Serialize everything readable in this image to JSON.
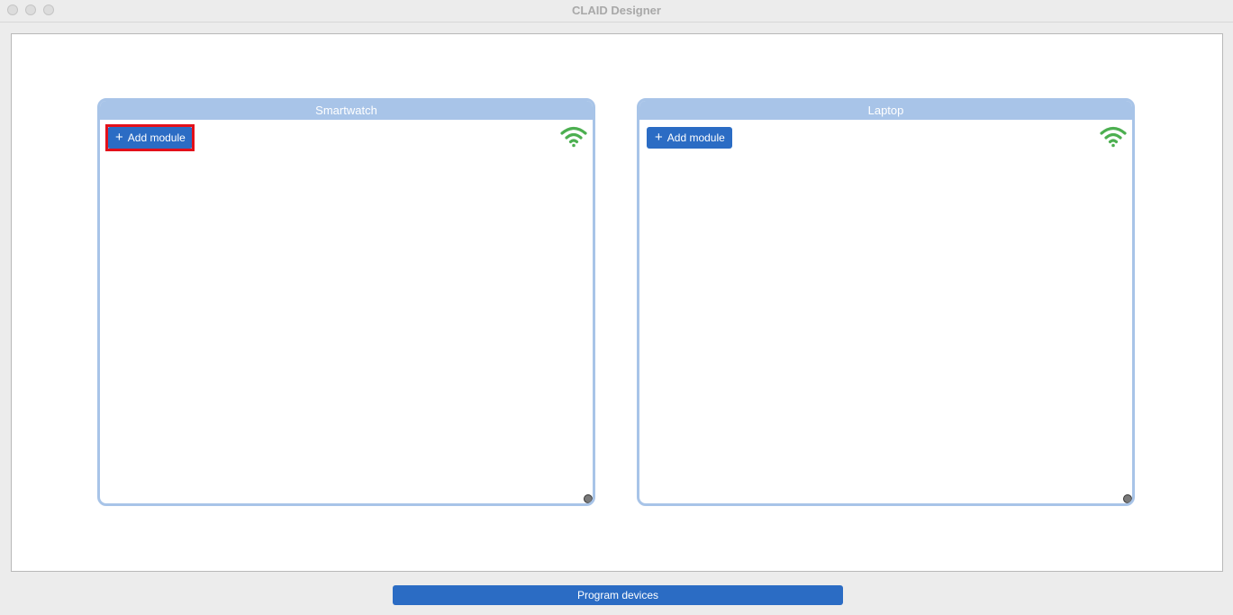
{
  "window": {
    "title": "CLAID Designer"
  },
  "devices": [
    {
      "name": "Smartwatch",
      "add_module_label": "Add module",
      "connection_icon": "wifi-icon",
      "highlighted": true
    },
    {
      "name": "Laptop",
      "add_module_label": "Add module",
      "connection_icon": "wifi-icon",
      "highlighted": false
    }
  ],
  "footer": {
    "program_button_label": "Program devices"
  },
  "colors": {
    "accent": "#2b6cc4",
    "device_border": "#a8c4e8",
    "wifi_connected": "#4caf50",
    "highlight": "#e3101a"
  }
}
